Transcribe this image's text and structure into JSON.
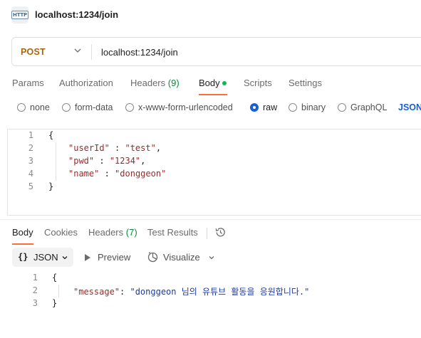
{
  "window": {
    "title": "localhost:1234/join",
    "icon": "http-icon"
  },
  "request": {
    "method": "POST",
    "url": "localhost:1234/join"
  },
  "request_tabs": [
    {
      "label": "Params"
    },
    {
      "label": "Authorization"
    },
    {
      "label": "Headers",
      "count": "(9)"
    },
    {
      "label": "Body",
      "active": true
    },
    {
      "label": "Scripts"
    },
    {
      "label": "Settings"
    }
  ],
  "body_types": {
    "options": [
      "none",
      "form-data",
      "x-www-form-urlencoded",
      "raw",
      "binary",
      "GraphQL"
    ],
    "selected": "raw",
    "format": "JSON"
  },
  "request_body": {
    "line_numbers": [
      "1",
      "2",
      "3",
      "4",
      "5"
    ],
    "open_brace": "{",
    "close_brace": "}",
    "fields": [
      {
        "key": "\"userId\"",
        "sep": " : ",
        "value": "\"test\"",
        "trail": ","
      },
      {
        "key": "\"pwd\"",
        "sep": " : ",
        "value": "\"1234\"",
        "trail": ","
      },
      {
        "key": "\"name\"",
        "sep": " : ",
        "value": "\"donggeon\"",
        "trail": ""
      }
    ]
  },
  "response_tabs": [
    {
      "label": "Body",
      "active": true
    },
    {
      "label": "Cookies"
    },
    {
      "label": "Headers",
      "count": "(7)"
    },
    {
      "label": "Test Results"
    }
  ],
  "response_toolbar": {
    "format_braces": "{}",
    "format_label": "JSON",
    "preview_label": "Preview",
    "visualize_label": "Visualize"
  },
  "response_body": {
    "line_numbers": [
      "1",
      "2",
      "3"
    ],
    "open_brace": "{",
    "close_brace": "}",
    "key": "\"message\"",
    "sep": ": ",
    "value": "\"donggeon 님의 유튜브 활동을 응원합니다.\""
  },
  "colors": {
    "method": "#a8650a",
    "accent_underline": "#ff6c37",
    "selected_radio": "#1a5ed8",
    "status_dot": "#0cbb52",
    "count": "#0a8a3a"
  }
}
